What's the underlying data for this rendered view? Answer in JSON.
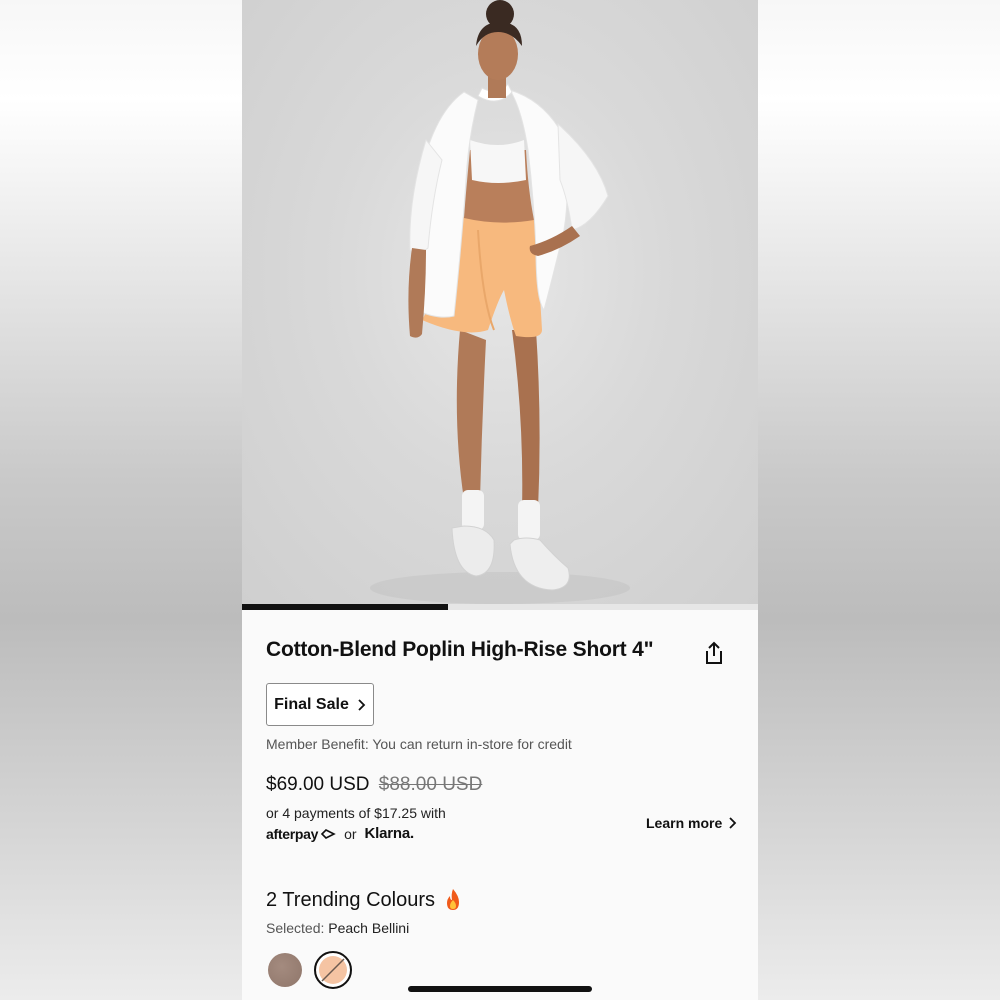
{
  "product": {
    "title": "Cotton-Blend Poplin High-Rise Short 4\"",
    "final_sale_label": "Final Sale",
    "member_benefit": "Member Benefit: You can return in-store for credit",
    "price": "$69.00 USD",
    "original_price": "$88.00 USD",
    "installments": "or 4 payments of $17.25 with",
    "afterpay": "afterpay",
    "or_label": "or",
    "klarna": "Klarna.",
    "learn_more": "Learn more"
  },
  "colours": {
    "heading": "2 Trending Colours",
    "selected_label": "Selected:",
    "selected_value": "Peach Bellini",
    "swatches": [
      {
        "name": "taupe",
        "color": "#9c8377"
      },
      {
        "name": "Peach Bellini",
        "color": "#f5c4a3",
        "selected": true
      }
    ]
  },
  "image_gallery": {
    "progress": 0.4
  },
  "icons": [
    "share-icon",
    "chevron-right-icon",
    "fire-icon",
    "afterpay-arrows-icon"
  ]
}
